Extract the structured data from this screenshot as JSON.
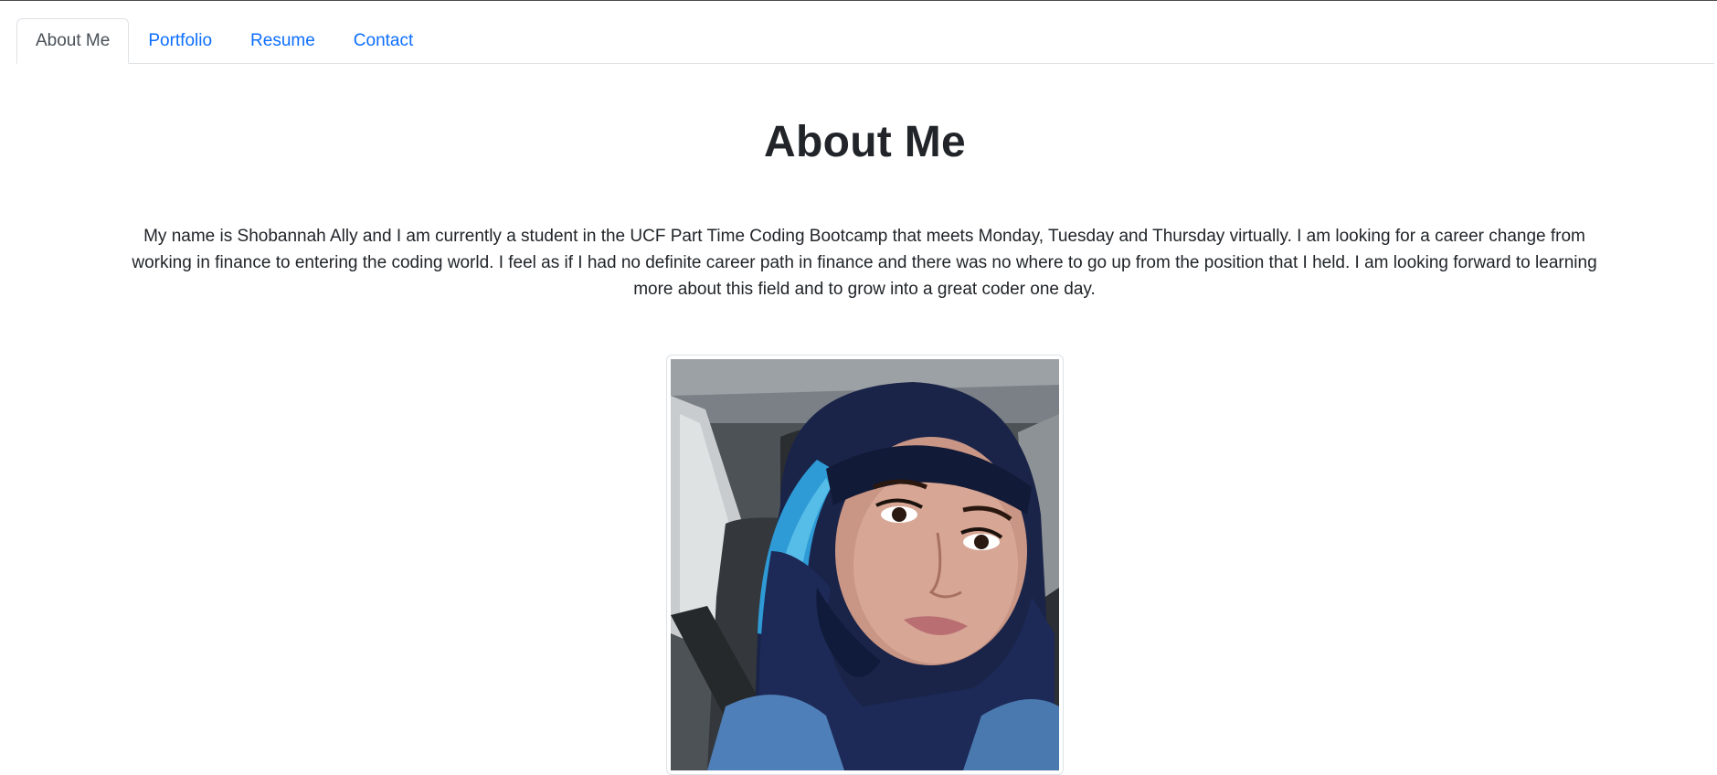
{
  "nav": {
    "tabs": [
      {
        "label": "About Me",
        "active": true
      },
      {
        "label": "Portfolio",
        "active": false
      },
      {
        "label": "Resume",
        "active": false
      },
      {
        "label": "Contact",
        "active": false
      }
    ]
  },
  "main": {
    "title": "About Me",
    "intro": "My name is Shobannah Ally and I am currently a student in the UCF Part Time Coding Bootcamp that meets Monday, Tuesday and Thursday virtually. I am looking for a career change from working in finance to entering the coding world. I feel as if I had no definite career path in finance and there was no where to go up from the position that I held. I am looking forward to learning more about this field and to grow into a great coder one day.",
    "photo": {
      "icon": "profile-photo"
    }
  },
  "colors": {
    "link": "#0d6efd",
    "active_tab_text": "#495057",
    "text": "#212529",
    "border": "#dee2e6"
  }
}
